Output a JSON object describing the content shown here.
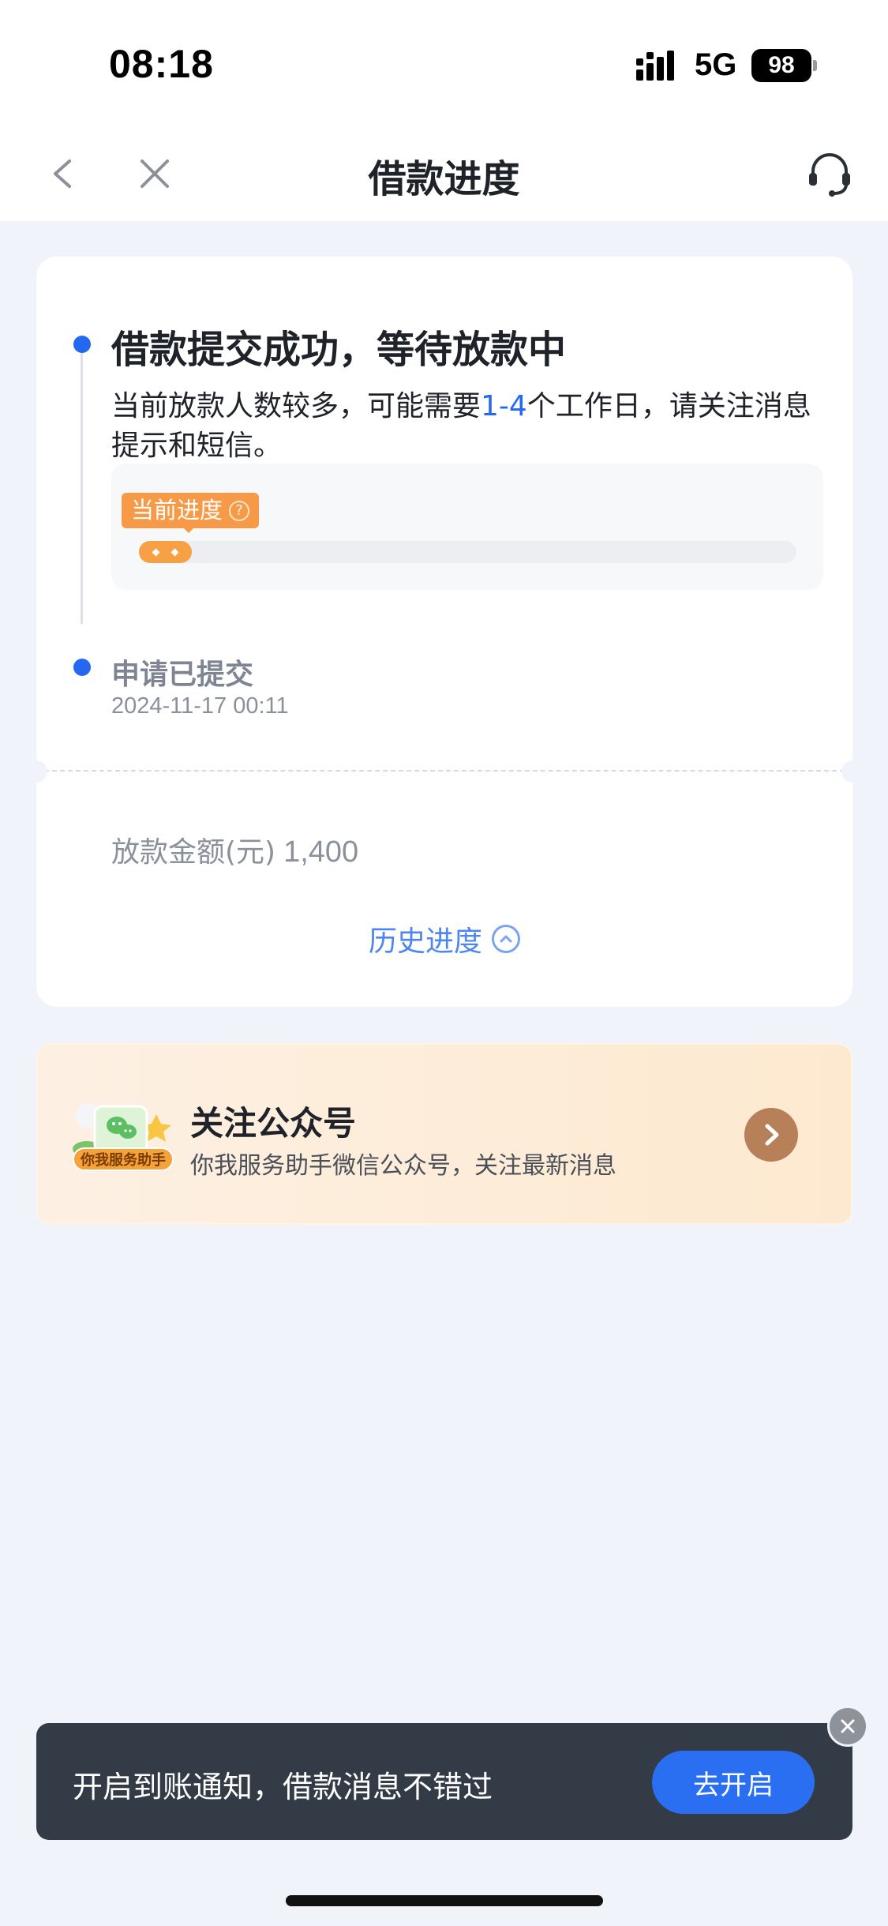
{
  "status_bar": {
    "time": "08:18",
    "network": "5G",
    "battery": "98",
    "icons": [
      "signal-icon",
      "battery-icon"
    ]
  },
  "nav": {
    "title": "借款进度",
    "icons": [
      "back-arrow-icon",
      "close-icon",
      "customer-service-icon"
    ]
  },
  "status": {
    "title": "借款提交成功，等待放款中",
    "desc_before": "当前放款人数较多，可能需要",
    "desc_highlight": "1-4",
    "desc_after": "个工作日，请关注消息提示和短信。",
    "progress_tag": "当前进度",
    "progress_fraction": 0.08
  },
  "submitted": {
    "label": "申请已提交",
    "time": "2024-11-17 00:11"
  },
  "amount": {
    "label": "放款金额(元)",
    "value": "1,400"
  },
  "history_link": "历史进度",
  "follow": {
    "title": "关注公众号",
    "subtitle": "你我服务助手微信公众号，关注最新消息",
    "badge": "你我服务助手"
  },
  "notify": {
    "text": "开启到账通知，借款消息不错过",
    "button": "去开启"
  },
  "colors": {
    "accent": "#2468f2",
    "progress": "#f7a044",
    "background": "#f0f3f9",
    "toast": "#333b47"
  }
}
